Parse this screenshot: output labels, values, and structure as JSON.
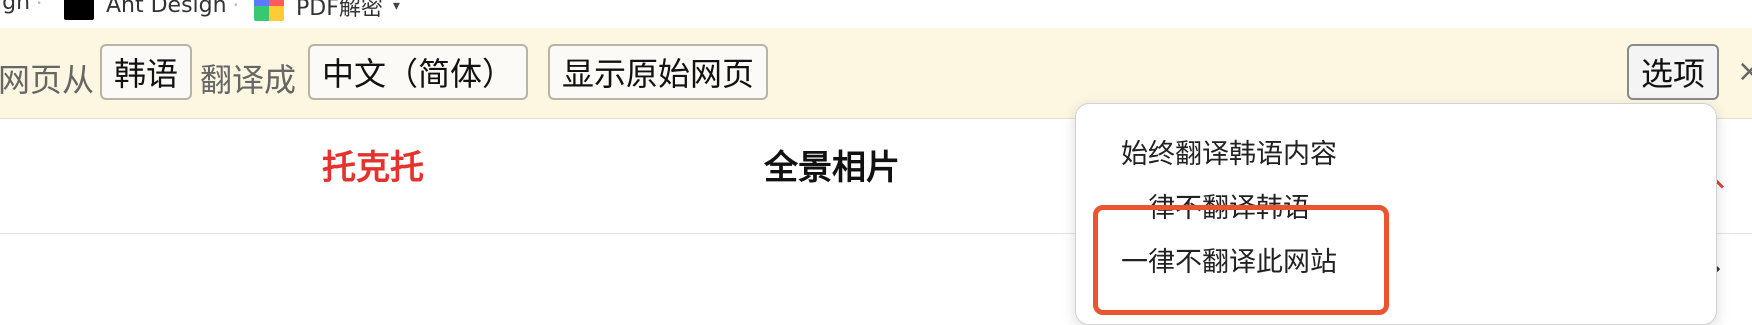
{
  "bookmarks": {
    "items": [
      {
        "label": "ign",
        "icon": null
      },
      {
        "label": "Ant Design",
        "icon": "ant-design-logo-icon"
      },
      {
        "label": "PDF解密",
        "icon": "pdf-colorful-icon"
      }
    ]
  },
  "translate_bar": {
    "from_label": "网页从",
    "source_language": "韩语",
    "to_label": "翻译成",
    "target_language": "中文（简体）",
    "show_original_label": "显示原始网页",
    "options_label": "选项",
    "colors": {
      "background": "#fdf7e2",
      "border": "#b9b4a6"
    }
  },
  "menu": {
    "items": [
      "始终翻译韩语内容",
      "一律不翻译韩语",
      "一律不翻译此网站"
    ],
    "highlight_color": "#e8552e"
  },
  "page": {
    "nav_red": "托克托",
    "nav_black": "全景相片",
    "accent_red": "#e5322d"
  }
}
